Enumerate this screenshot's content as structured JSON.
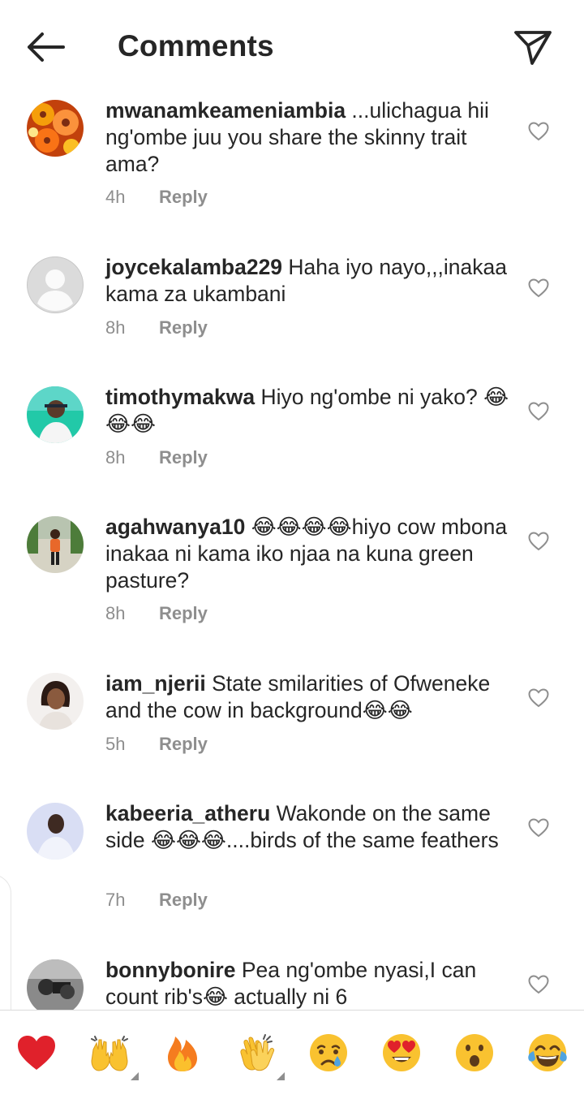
{
  "header": {
    "title": "Comments",
    "back_icon": "arrow-left-icon",
    "share_icon": "paper-plane-icon"
  },
  "comments": [
    {
      "username": "mwanamkeameniambia",
      "text": " ...ulichagua hii ng'ombe juu you share the skinny trait ama?",
      "time": "4h",
      "reply": "Reply",
      "avatar": "orange-flowers"
    },
    {
      "username": "joycekalamba229",
      "text": " Haha iyo nayo,,,inakaa kama za ukambani",
      "time": "8h",
      "reply": "Reply",
      "avatar": "default-avatar"
    },
    {
      "username": "timothymakwa",
      "text": " Hiyo ng'ombe ni yako? 😂😂😂",
      "time": "8h",
      "reply": "Reply",
      "avatar": "person-photo"
    },
    {
      "username": "agahwanya10",
      "text": " 😂😂😂😂hiyo cow mbona inakaa ni kama iko njaa na kuna green pasture?",
      "time": "8h",
      "reply": "Reply",
      "avatar": "person-photo"
    },
    {
      "username": "iam_njerii",
      "text": " State smilarities of Ofweneke and the cow in background😂😂",
      "time": "5h",
      "reply": "Reply",
      "avatar": "person-photo"
    },
    {
      "username": "kabeeria_atheru",
      "text": " Wakonde on the same side 😂😂😂....birds of the same feathers",
      "time": "7h",
      "reply": "Reply",
      "avatar": "person-photo"
    },
    {
      "username": "bonnybonire",
      "text": " Pea ng'ombe nyasi,I can count rib's😂 actually ni 6",
      "time": "",
      "reply": "",
      "avatar": "person-photo"
    }
  ],
  "emoji_bar": [
    {
      "name": "red-heart-emoji"
    },
    {
      "name": "raising-hands-emoji"
    },
    {
      "name": "fire-emoji"
    },
    {
      "name": "clapping-hands-emoji"
    },
    {
      "name": "crying-face-emoji"
    },
    {
      "name": "heart-eyes-emoji"
    },
    {
      "name": "surprised-face-emoji"
    },
    {
      "name": "tears-of-joy-emoji"
    }
  ],
  "colors": {
    "text": "#262626",
    "muted": "#8e8e8e",
    "divider": "#dbdbdb",
    "emoji_yellow": "#f9c230",
    "heart_red": "#e0212b"
  }
}
